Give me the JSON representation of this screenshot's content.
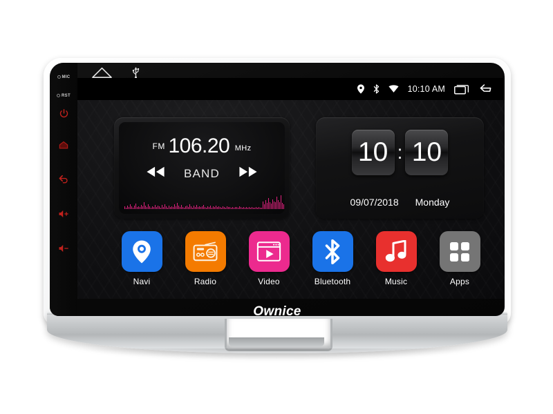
{
  "device": {
    "brand": "Ownice",
    "bezel_color": "#d3d6d8",
    "screen_bg": "#121214"
  },
  "hardkeys": {
    "labels": [
      {
        "name": "mic",
        "text": "MIC"
      },
      {
        "name": "reset",
        "text": "RST"
      }
    ],
    "buttons": [
      {
        "name": "power",
        "icon": "power-icon"
      },
      {
        "name": "home",
        "icon": "home-icon"
      },
      {
        "name": "back",
        "icon": "back-icon"
      },
      {
        "name": "volume-up",
        "icon": "volume-up-icon"
      },
      {
        "name": "volume-down",
        "icon": "volume-down-icon"
      }
    ],
    "accent_color": "#c0211c"
  },
  "topbar": {
    "home_icon": "home-outline-icon",
    "usb_icon": "usb-icon"
  },
  "statusbar": {
    "icons": [
      "location-pin-icon",
      "bluetooth-icon",
      "wifi-icon"
    ],
    "time": "10:10 AM",
    "recents_icon": "recent-apps-icon",
    "back_icon": "back-arrow-icon"
  },
  "radio_widget": {
    "band_prefix": "FM",
    "frequency": "106.20",
    "unit": "MHz",
    "band_label": "BAND",
    "prev_icon": "rewind-icon",
    "next_icon": "fast-forward-icon",
    "spectrum_color": "#e0217e",
    "spectrum_levels": [
      10,
      5,
      13,
      8,
      18,
      10,
      6,
      14,
      22,
      9,
      12,
      7,
      16,
      11,
      26,
      14,
      8,
      19,
      10,
      6,
      12,
      9,
      17,
      7,
      13,
      10,
      5,
      15,
      8,
      20,
      11,
      6,
      14,
      9,
      12,
      7,
      18,
      10,
      24,
      13,
      8,
      16,
      9,
      5,
      11,
      14,
      7,
      19,
      10,
      6,
      13,
      8,
      15,
      9,
      12,
      7,
      10,
      17,
      8,
      5,
      11,
      9,
      14,
      6,
      10,
      8,
      13,
      7,
      12,
      9,
      6,
      11,
      8,
      5,
      10,
      7,
      9,
      6,
      8,
      5,
      7,
      9,
      6,
      10,
      8,
      5,
      7,
      6,
      9,
      5,
      8,
      6,
      7,
      5,
      6,
      8,
      5,
      7,
      6,
      5,
      30,
      20,
      34,
      25,
      44,
      28,
      22,
      38,
      30,
      26,
      48,
      34,
      28,
      55,
      24,
      20,
      42,
      30,
      36,
      26,
      92,
      62,
      40,
      30,
      58,
      22,
      46,
      18,
      34,
      24
    ]
  },
  "clock_widget": {
    "hours": "10",
    "separator": ":",
    "minutes": "10",
    "date": "09/07/2018",
    "weekday": "Monday"
  },
  "dock": {
    "items": [
      {
        "label": "Navi",
        "icon": "location-pin-icon",
        "color": "#1a73e8"
      },
      {
        "label": "Radio",
        "icon": "radio-icon",
        "color": "#f47b00"
      },
      {
        "label": "Video",
        "icon": "video-player-icon",
        "color": "#ec2a8e"
      },
      {
        "label": "Bluetooth",
        "icon": "bluetooth-icon",
        "color": "#1a73e8"
      },
      {
        "label": "Music",
        "icon": "music-note-icon",
        "color": "#e8302e"
      },
      {
        "label": "Apps",
        "icon": "apps-grid-icon",
        "color": "#757575"
      }
    ]
  }
}
